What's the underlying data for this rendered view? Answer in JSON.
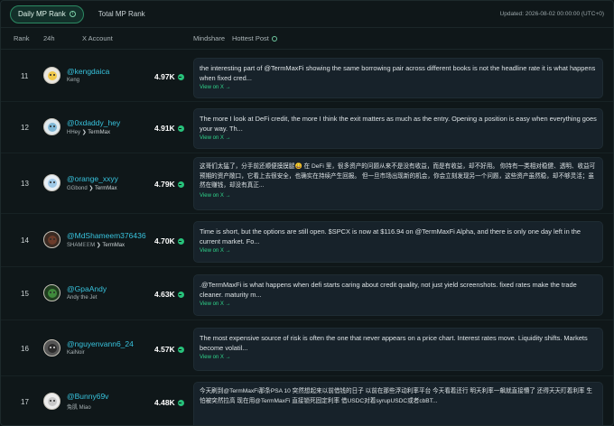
{
  "tabs": {
    "daily": "Daily MP Rank",
    "total": "Total MP Rank",
    "updated": "Updated: 2026-08-02 00:00:00 (UTC+0)"
  },
  "columns": {
    "rank": "Rank",
    "h24": "24h",
    "account": "X Account",
    "mindshare": "Mindshare",
    "hottest": "Hottest Post"
  },
  "rows": [
    {
      "rank": "11",
      "handle": "@kengdaica",
      "name": "Keng",
      "affiliation": "",
      "score": "4.97K",
      "post": "the interesting part of @TermMaxFi showing the same borrowing pair across different books is not the headline rate it is what happens when fixed cred...",
      "link": "View on X →",
      "avatar_color": "#f0c84a"
    },
    {
      "rank": "12",
      "handle": "@0xdaddy_hey",
      "name": "HHey",
      "affiliation": "TermMax",
      "score": "4.91K",
      "post": "The more I look at DeFi credit, the more I think the exit matters as much as the entry. Opening a position is easy when everything goes your way. Th...",
      "link": "View on X →",
      "avatar_color": "#7fb7d6"
    },
    {
      "rank": "13",
      "handle": "@orange_xxyy",
      "name": "GGbond",
      "affiliation": "TermMax",
      "score": "4.79K",
      "post": "这哥们太猛了，分手前还顺便摸摸腿😄 在 DeFi 里，很多资产的问题从来不是没有收益，而是有收益，却不好用。 你持有一类相对稳健、透明、收益可预期的资产敞口，它看上去很安全，也确实在持续产生回报。 但一旦市场出现新的机会，你会立刻发现另一个问题，这些资产虽然稳，却不够灵活；虽然在赚钱，却没有真正...",
      "link": "View on X →",
      "avatar_color": "#9fc9e8"
    },
    {
      "rank": "14",
      "handle": "@MdShameem376436",
      "name": "SHAM𝔼𝔼M",
      "affiliation": "TermMax",
      "score": "4.70K",
      "post": "Time is short, but the options are still open. $SPCX is now at $116.94 on @TermMaxFi Alpha, and there is only one day left in the current market. Fo...",
      "link": "View on X →",
      "avatar_color": "#6b3b2a"
    },
    {
      "rank": "15",
      "handle": "@GpaAndy",
      "name": "Andy the Jet",
      "affiliation": "",
      "score": "4.63K",
      "post": ".@TermMaxFi is what happens when defi starts caring about credit quality, not just yield screenshots. fixed rates make the trade cleaner. maturity m...",
      "link": "View on X →",
      "avatar_color": "#3f8a3c"
    },
    {
      "rank": "16",
      "handle": "@nguyenvann6_24",
      "name": "KaiNoir",
      "affiliation": "",
      "score": "4.57K",
      "post": "The most expensive source of risk is often the one that never appears on a price chart. Interest rates move. Liquidity shifts. Markets become volatil...",
      "link": "View on X →",
      "avatar_color": "#2b2b2b"
    },
    {
      "rank": "17",
      "handle": "@Bunny69v",
      "name": "兔肌 Miao",
      "affiliation": "",
      "score": "4.48K",
      "post": "今天刷到@TermMaxFi那条PSA 10 突然想起来以前借钱的日子 以前在那些浮动利率平台 今天看着还行 明天利率一飙就直接懵了 还得天天盯着利率 生怕被突然拉高 现在用@TermMaxFi 直接锁死固定利率 借USDC对着syrupUSDC或者cbBT...",
      "link": "",
      "avatar_color": "#c9c9c9"
    }
  ]
}
